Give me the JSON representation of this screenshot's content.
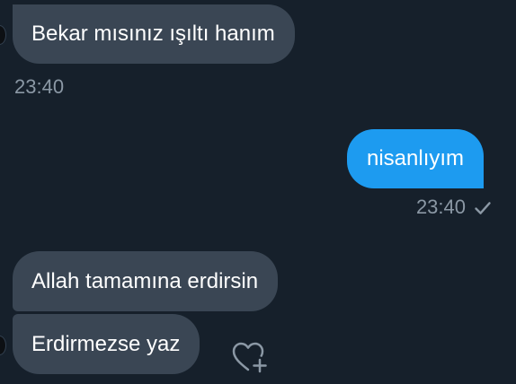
{
  "conversation": {
    "messages": [
      {
        "direction": "incoming",
        "text": "Bekar mısınız ışıltı hanım"
      },
      {
        "direction": "outgoing",
        "text": "nisanlıyım"
      },
      {
        "direction": "incoming",
        "text": "Allah tamamına erdirsin"
      },
      {
        "direction": "incoming",
        "text": "Erdirmezse yaz"
      }
    ],
    "timestamps": {
      "incoming_first": "23:40",
      "outgoing": "23:40"
    }
  },
  "icons": {
    "sent_status": "checkmark-icon",
    "reaction": "heart-add-icon"
  },
  "colors": {
    "background": "#16202b",
    "incoming_bubble": "#3a4654",
    "outgoing_bubble": "#1d9bf0",
    "timestamp": "#8b98a5",
    "text": "#ffffff"
  }
}
